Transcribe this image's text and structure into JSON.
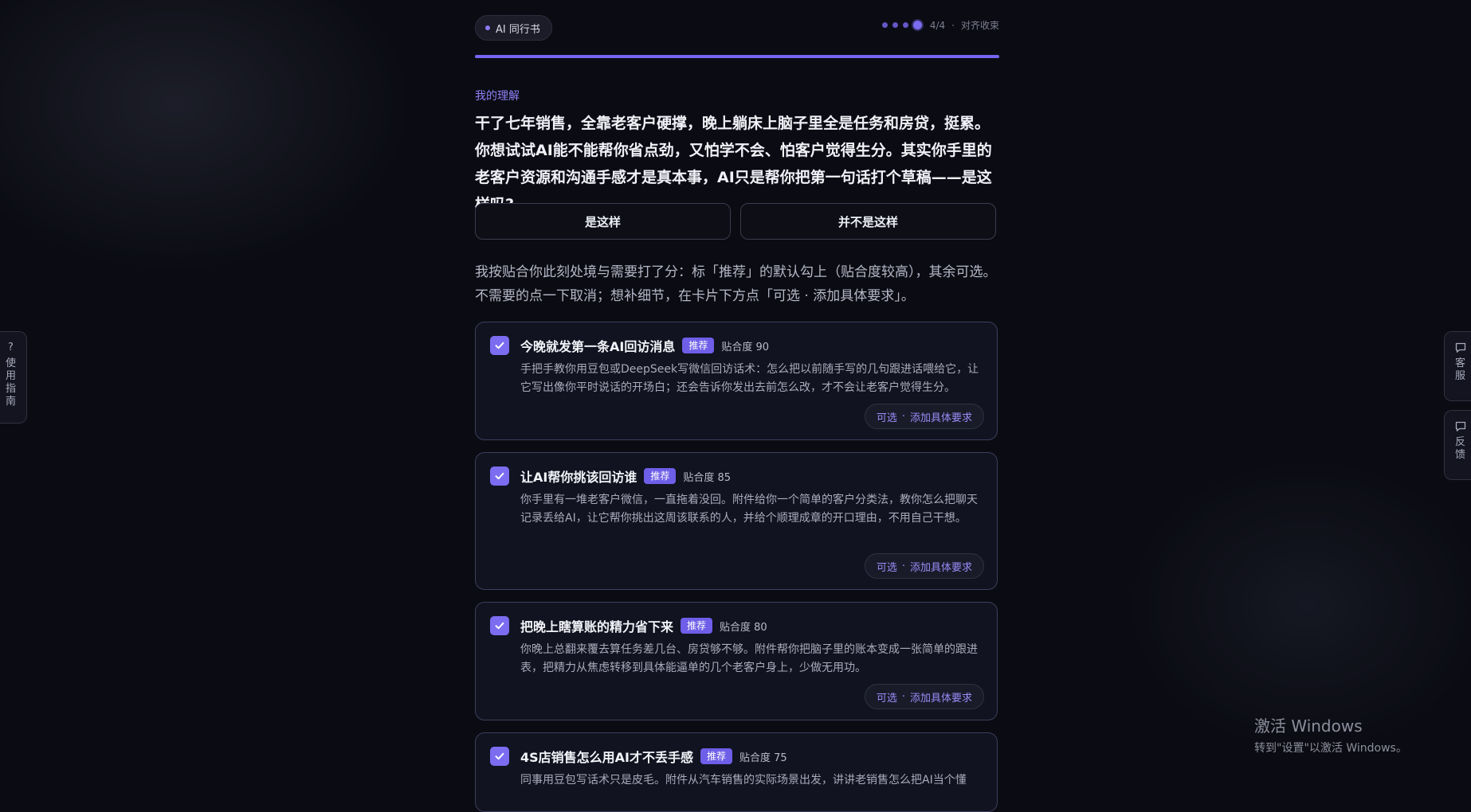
{
  "header": {
    "brand": "AI 同行书",
    "step": "4/4",
    "step_sep": "·",
    "step_label": "对齐收束"
  },
  "understanding": {
    "label": "我的理解",
    "text": "干了七年销售，全靠老客户硬撑，晚上躺床上脑子里全是任务和房贷，挺累。你想试试AI能不能帮你省点劲，又怕学不会、怕客户觉得生分。其实你手里的老客户资源和沟通手感才是真本事，AI只是帮你把第一句话打个草稿——是这样吗?",
    "yes_label": "是这样",
    "no_label": "并不是这样"
  },
  "instructions": "我按贴合你此刻处境与需要打了分：标「推荐」的默认勾上（贴合度较高），其余可选。不需要的点一下取消；想补细节，在卡片下方点「可选 · 添加具体要求」。",
  "cards": [
    {
      "title": "今晚就发第一条AI回访消息",
      "badge": "推荐",
      "score": "贴合度 90",
      "desc": "手把手教你用豆包或DeepSeek写微信回访话术：怎么把以前随手写的几句跟进话喂给它，让它写出像你平时说话的开场白；还会告诉你发出去前怎么改，才不会让老客户觉得生分。",
      "opt_a": "可选",
      "opt_sep": "·",
      "opt_b": "添加具体要求",
      "checked": true
    },
    {
      "title": "让AI帮你挑该回访谁",
      "badge": "推荐",
      "score": "贴合度 85",
      "desc": "你手里有一堆老客户微信，一直拖着没回。附件给你一个简单的客户分类法，教你怎么把聊天记录丢给AI，让它帮你挑出这周该联系的人，并给个顺理成章的开口理由，不用自己干想。",
      "opt_a": "可选",
      "opt_sep": "·",
      "opt_b": "添加具体要求",
      "checked": true
    },
    {
      "title": "把晚上瞎算账的精力省下来",
      "badge": "推荐",
      "score": "贴合度 80",
      "desc": "你晚上总翻来覆去算任务差几台、房贷够不够。附件帮你把脑子里的账本变成一张简单的跟进表，把精力从焦虑转移到具体能逼单的几个老客户身上，少做无用功。",
      "opt_a": "可选",
      "opt_sep": "·",
      "opt_b": "添加具体要求",
      "checked": true
    },
    {
      "title": "4S店销售怎么用AI才不丢手感",
      "badge": "推荐",
      "score": "贴合度 75",
      "desc": "同事用豆包写话术只是皮毛。附件从汽车销售的实际场景出发，讲讲老销售怎么把AI当个懂",
      "checked": true
    }
  ],
  "side": {
    "guide_icon": "?",
    "guide_chars": [
      "使",
      "用",
      "指",
      "南"
    ],
    "service_chars": [
      "客",
      "服"
    ],
    "feedback_chars": [
      "反",
      "馈"
    ]
  },
  "watermark": {
    "title": "激活 Windows",
    "subtitle": "转到\"设置\"以激活 Windows。"
  },
  "colors": {
    "background": "#0b0c13",
    "accent": "#7b6cf0",
    "card_border": "#3c3f5c"
  }
}
